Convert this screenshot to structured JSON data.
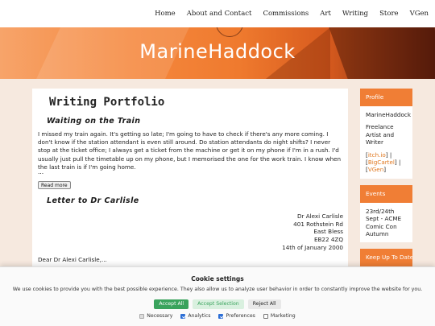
{
  "nav": {
    "items": [
      "Home",
      "About and Contact",
      "Commissions",
      "Art",
      "Writing",
      "Store",
      "VGen"
    ]
  },
  "banner": {
    "site_title": "MarineHaddock"
  },
  "main": {
    "page_title": "Writing Portfolio",
    "post1": {
      "title": "Waiting on the Train",
      "body": "I missed my train again. It's getting so late; I'm going to have to check if there's any more coming. I don't know if the station attendant is even still around. Do station attendants do night shifts? I never stop at the ticket office; I always get a ticket from the machine or get it on my phone if I'm in a rush. I'd usually just pull the timetable up on my phone, but I memorised the one for the work train. I know when the last train is if I'm going home.",
      "ellipsis": "...",
      "read_more": "Read more"
    },
    "post2": {
      "title": "Letter to Dr Carlisle",
      "address_lines": [
        "Dr Alexi Carlisle",
        "401 Rothstein Rd",
        "East Bless",
        "EB22 4ZQ"
      ],
      "date": "14th of January 2000",
      "salutation": "Dear Dr Alexi Carlisle,..."
    }
  },
  "sidebar": {
    "profile": {
      "header": "Profile",
      "name": "MarineHaddock",
      "role": "Freelance Artist and Writer",
      "links": [
        "itch.io",
        "BigCartel",
        "VGen"
      ]
    },
    "events": {
      "header": "Events",
      "text": "23rd/24th Sept - ACME Comic Con Autumn"
    },
    "keep_up": {
      "header": "Keep Up To Date"
    }
  },
  "cookie": {
    "title": "Cookie settings",
    "text": "We use cookies to provide you with the best possible experience. They also allow us to analyze user behavior in order to constantly improve the website for you.",
    "buttons": {
      "accept_all": "Accept All",
      "accept_selection": "Accept Selection",
      "reject_all": "Reject All"
    },
    "checks": [
      {
        "label": "Necessary",
        "checked": true,
        "disabled": true
      },
      {
        "label": "Analytics",
        "checked": true,
        "disabled": false
      },
      {
        "label": "Preferences",
        "checked": true,
        "disabled": false
      },
      {
        "label": "Marketing",
        "checked": false,
        "disabled": false
      }
    ]
  },
  "colors": {
    "accent": "#f07e35",
    "accept_green": "#3aa35d",
    "page_bg": "#f6e9df"
  }
}
